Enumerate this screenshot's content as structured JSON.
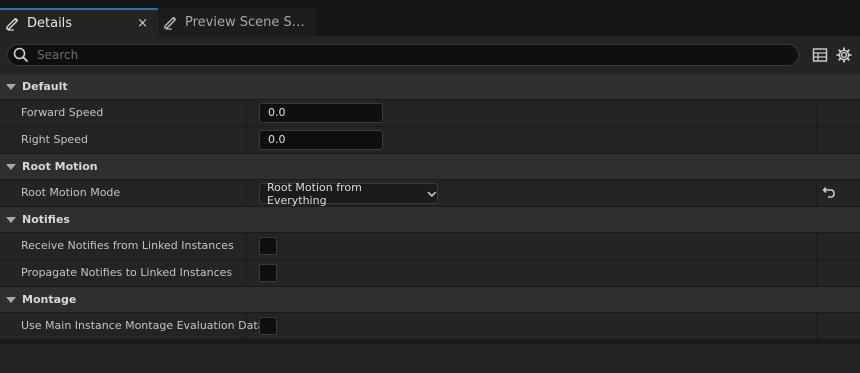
{
  "tabs": [
    {
      "label": "Details",
      "active": true,
      "close": "×"
    },
    {
      "label": "Preview Scene S…",
      "active": false
    }
  ],
  "search": {
    "placeholder": "Search"
  },
  "categories": [
    {
      "label": "Default",
      "rows": [
        {
          "label": "Forward Speed",
          "type": "number",
          "value": "0.0"
        },
        {
          "label": "Right Speed",
          "type": "number",
          "value": "0.0"
        }
      ]
    },
    {
      "label": "Root Motion",
      "rows": [
        {
          "label": "Root Motion Mode",
          "type": "combo",
          "value": "Root Motion from Everything",
          "reset_icon": "reset-arrow-icon"
        }
      ]
    },
    {
      "label": "Notifies",
      "rows": [
        {
          "label": "Receive Notifies from Linked Instances",
          "type": "checkbox",
          "checked": false
        },
        {
          "label": "Propagate Notifies to Linked Instances",
          "type": "checkbox",
          "checked": false
        }
      ]
    },
    {
      "label": "Montage",
      "rows": [
        {
          "label": "Use Main Instance Montage Evaluation Data",
          "type": "checkbox",
          "checked": false
        }
      ]
    }
  ],
  "icons": {
    "tab_details": "pencil-icon",
    "tab_preview": "pencil-icon",
    "search": "search-icon",
    "grid_view": "table-grid-icon",
    "settings": "gear-icon"
  },
  "colors": {
    "accent": "#2d6fb5",
    "background": "#242424",
    "category": "#2f2f2f"
  }
}
